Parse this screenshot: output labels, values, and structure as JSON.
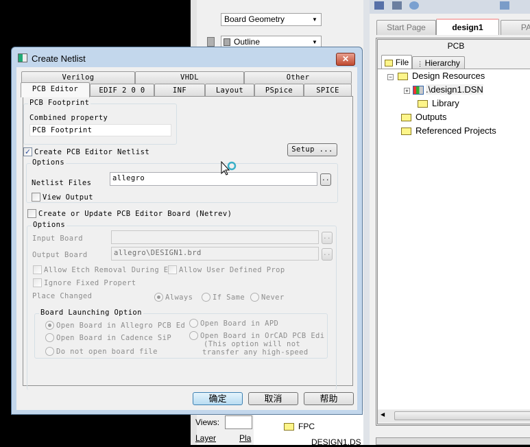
{
  "bg_panel": {
    "layer_combo": "Board Geometry",
    "subclass_combo": "Outline",
    "views_label": "Views:",
    "layer_label": "Layer",
    "plan_label": "Pla"
  },
  "bottom_list": {
    "items": [
      "FPC",
      "DESIGN1.DS"
    ]
  },
  "project": {
    "tabs": [
      "Start Page",
      "design1",
      "PA"
    ],
    "header": "PCB",
    "subtabs": [
      "File",
      "Hierarchy"
    ],
    "tree": [
      "Design Resources",
      ".\\design1.DSN",
      "Library",
      "Outputs",
      "Referenced Projects"
    ]
  },
  "dialog": {
    "title": "Create Netlist",
    "tabs_row1": [
      "Verilog",
      "VHDL",
      "Other"
    ],
    "tabs_row2": [
      "PCB Editor",
      "EDIF 2 0 0",
      "INF",
      "Layout",
      "PSpice",
      "SPICE"
    ],
    "footprint_group": "PCB Footprint",
    "combined_label": "Combined property",
    "combined_value": "PCB Footprint",
    "create_netlist": "Create PCB Editor Netlist",
    "setup": "Setup ...",
    "options1": "Options",
    "netlist_files_label": "Netlist Files",
    "netlist_files_value": "allegro",
    "browse": "..",
    "view_output": "View Output",
    "netrev": "Create or Update PCB Editor Board (Netrev)",
    "options2": "Options",
    "input_board_label": "Input Board",
    "input_board_value": "",
    "output_board_label": "Output Board",
    "output_board_value": "allegro\\DESIGN1.brd",
    "allow_etch": "Allow Etch Removal During E",
    "allow_user": "Allow User Defined Prop",
    "ignore_fixed": "Ignore Fixed Propert",
    "place_changed": "Place Changed",
    "place_opts": [
      "Always",
      "If Same",
      "Never"
    ],
    "launch_group": "Board Launching Option",
    "launch_opts": [
      "Open Board in Allegro PCB Ed",
      "Open Board in Cadence SiP",
      "Do not open board file",
      "Open Board in APD",
      "Open Board in OrCAD PCB Edi"
    ],
    "launch_note": [
      "(This option will not",
      "transfer any high-speed"
    ],
    "ok": "确定",
    "cancel": "取消",
    "help": "帮助"
  }
}
